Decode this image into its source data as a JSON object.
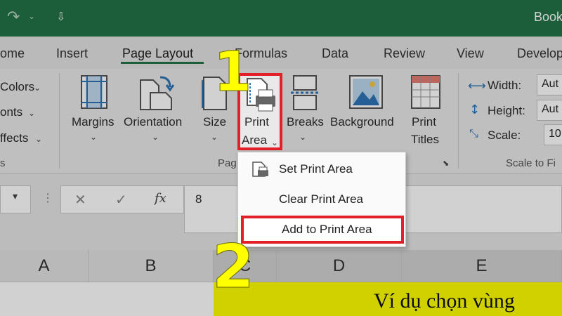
{
  "window": {
    "title": "Book",
    "qat_icon": "customize-qat-icon"
  },
  "ribbon_tabs": [
    {
      "label": "ome",
      "active": false
    },
    {
      "label": "Insert",
      "active": false
    },
    {
      "label": "Page Layout",
      "active": true
    },
    {
      "label": "Formulas",
      "active": false
    },
    {
      "label": "Data",
      "active": false
    },
    {
      "label": "Review",
      "active": false
    },
    {
      "label": "View",
      "active": false
    },
    {
      "label": "Develop",
      "active": false
    }
  ],
  "themes_group": {
    "colors": "Colors",
    "fonts": "onts",
    "effects": "ffects",
    "label": "s"
  },
  "page_setup": {
    "margins": "Margins",
    "orientation": "Orientation",
    "size": "Size",
    "print_area_line1": "Print",
    "print_area_line2": "Area",
    "breaks": "Breaks",
    "background": "Background",
    "print_titles_line1": "Print",
    "print_titles_line2": "Titles",
    "group_label": "Pag"
  },
  "scale_to_fit": {
    "width_label": "Width:",
    "width_value": "Aut",
    "height_label": "Height:",
    "height_value": "Aut",
    "scale_label": "Scale:",
    "scale_value": "10",
    "group_label": "Scale to Fi"
  },
  "print_area_menu": {
    "items": [
      {
        "label": "Set Print Area",
        "highlighted": false
      },
      {
        "label": "Clear Print Area",
        "highlighted": false
      },
      {
        "label": "Add to Print Area",
        "highlighted": true
      }
    ]
  },
  "formula_bar": {
    "cancel_symbol": "✕",
    "enter_symbol": "✓",
    "fx_symbol": "fx",
    "value": "8"
  },
  "columns": [
    "A",
    "B",
    "C",
    "D",
    "E"
  ],
  "cell_text": "Ví dụ chọn vùng",
  "annotations": {
    "step1": "1",
    "step2": "2"
  },
  "colors": {
    "excel_green": "#217346",
    "highlight_red": "#e2202a",
    "cell_yellow": "#ffff00",
    "step_yellow": "#ffff00"
  }
}
